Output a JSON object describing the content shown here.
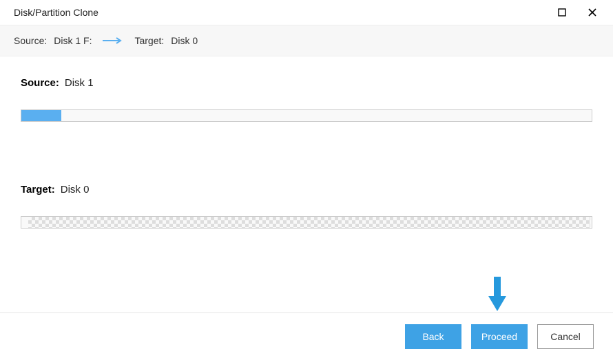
{
  "window": {
    "title": "Disk/Partition Clone"
  },
  "pathbar": {
    "source_label": "Source:",
    "source_value": "Disk 1 F:",
    "target_label": "Target:",
    "target_value": "Disk 0"
  },
  "source_section": {
    "label": "Source:",
    "value": "Disk 1"
  },
  "target_section": {
    "label": "Target:",
    "value": "Disk 0"
  },
  "buttons": {
    "back": "Back",
    "proceed": "Proceed",
    "cancel": "Cancel"
  },
  "colors": {
    "accent": "#3ea2e5",
    "arrow": "#2699dd"
  }
}
